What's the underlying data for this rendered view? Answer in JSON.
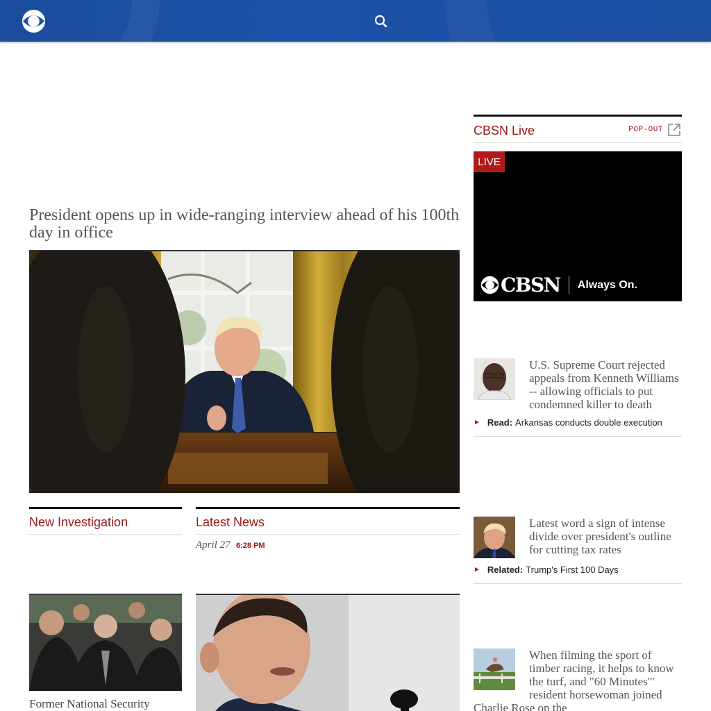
{
  "header": {
    "logo_icon": "cbs-eye-icon",
    "search_icon": "search-icon"
  },
  "lead": {
    "headline": "President opens up in wide-ranging interview ahead of his 100th day in office"
  },
  "sections": {
    "new_investigation": "New Investigation",
    "latest_news": "Latest News",
    "latest_date": "April 27",
    "latest_time": "6:28 PM"
  },
  "thumbs": {
    "first_caption": "Former National Security"
  },
  "live": {
    "title": "CBSN Live",
    "popout": "POP-OUT",
    "badge": "LIVE",
    "brand": "CBSN",
    "tagline": "Always On."
  },
  "stories": [
    {
      "text": "U.S. Supreme Court rejected appeals from Kenneth Williams -- allowing officials to put condemned killer to death",
      "sub_label": "Read:",
      "sub_text": "Arkansas conducts double execution"
    },
    {
      "text": "Latest word a sign of intense divide over president's outline for cutting tax rates",
      "sub_label": "Related:",
      "sub_text": "Trump's First 100 Days"
    },
    {
      "text": "When filming the sport of timber racing, it helps to know the turf, and \"60 Minutes'\" resident horsewoman joined Charlie Rose on the"
    }
  ],
  "colors": {
    "nav": "#1d52a8",
    "accent": "#a01818"
  }
}
